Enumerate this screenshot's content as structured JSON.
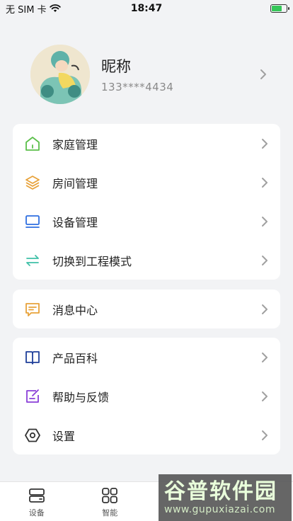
{
  "status_bar": {
    "carrier": "无 SIM 卡",
    "time": "18:47"
  },
  "profile": {
    "nickname": "昵称",
    "phone": "133****4434"
  },
  "menu_groups": [
    {
      "items": [
        {
          "label": "家庭管理",
          "icon": "home-icon",
          "color": "#5bbf4a"
        },
        {
          "label": "房间管理",
          "icon": "layers-icon",
          "color": "#e8a23a"
        },
        {
          "label": "设备管理",
          "icon": "monitor-icon",
          "color": "#2f6fe0"
        },
        {
          "label": "切换到工程模式",
          "icon": "switch-arrows-icon",
          "color": "#3fc0a8"
        }
      ]
    },
    {
      "items": [
        {
          "label": "消息中心",
          "icon": "message-icon",
          "color": "#e8a23a"
        }
      ]
    },
    {
      "items": [
        {
          "label": "产品百科",
          "icon": "book-icon",
          "color": "#1f3f9a"
        },
        {
          "label": "帮助与反馈",
          "icon": "edit-note-icon",
          "color": "#8a3fd8"
        },
        {
          "label": "设置",
          "icon": "hexagon-settings-icon",
          "color": "#333333"
        }
      ]
    }
  ],
  "tabbar": {
    "tabs": [
      {
        "label": "设备",
        "icon": "device-icon"
      },
      {
        "label": "智能",
        "icon": "grid-icon"
      }
    ]
  },
  "watermark": {
    "main": "谷普软件园",
    "sub": "www.gupuxiazai.com"
  }
}
